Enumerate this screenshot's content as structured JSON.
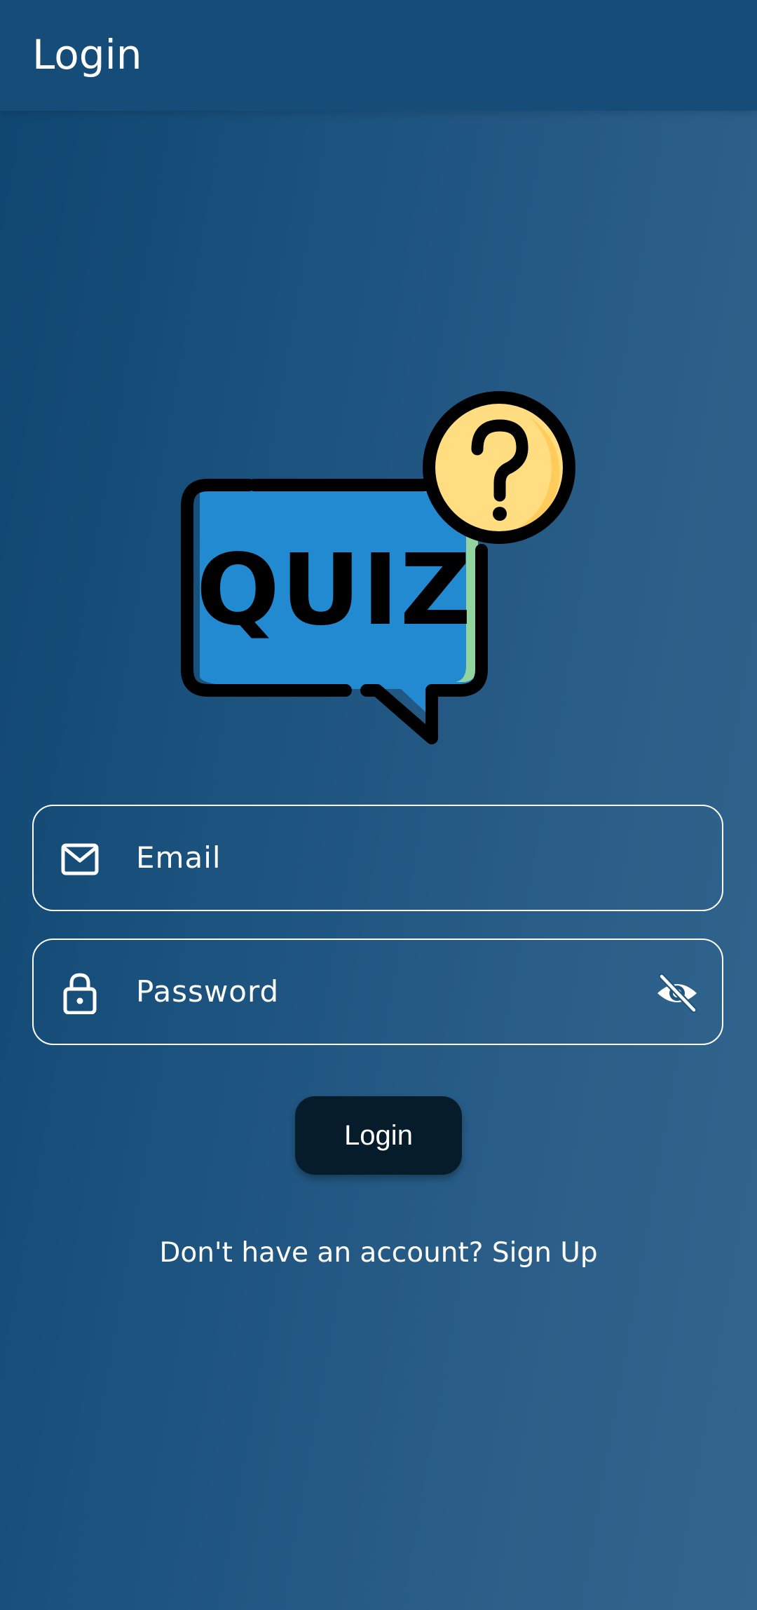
{
  "app_bar": {
    "title": "Login"
  },
  "logo": {
    "text": "QUIZ",
    "icon": "quiz-speech-bubble-question-icon"
  },
  "form": {
    "email": {
      "placeholder": "Email",
      "value": "",
      "icon": "mail-icon"
    },
    "password": {
      "placeholder": "Password",
      "value": "",
      "icon": "lock-icon",
      "toggle_icon": "eye-off-icon"
    },
    "login_label": "Login"
  },
  "signup": {
    "prompt": "Don't have an account?",
    "link": "Sign Up"
  },
  "colors": {
    "app_bar": "#164d78",
    "background_start": "#0f4670",
    "background_end": "#33658e",
    "button": "#061c2b",
    "bubble": "#218ad0",
    "question": "#ffdd80"
  }
}
